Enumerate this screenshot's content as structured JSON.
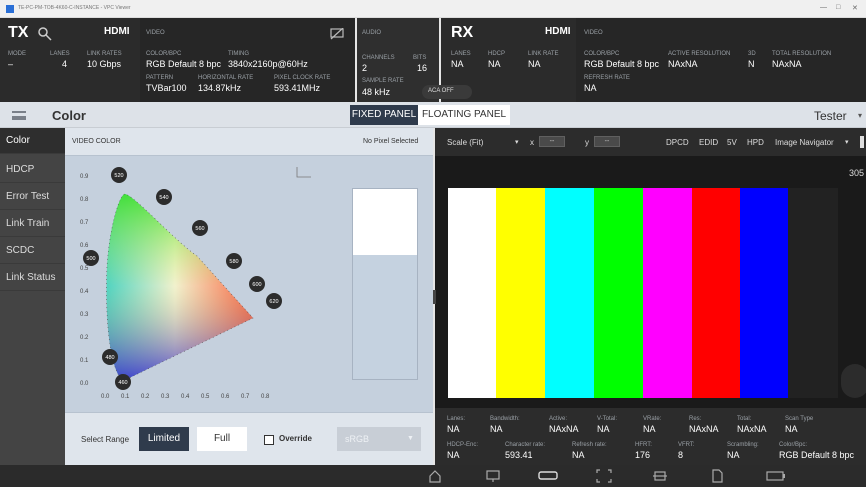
{
  "window": {
    "title": "TE-PC-PM-TOB-4K60-C-INSTANCE - VPC Viewer",
    "controls": [
      "—",
      "□",
      "✕"
    ]
  },
  "tx": {
    "label": "TX",
    "interface": "HDMI",
    "section": "VIDEO",
    "mode": {
      "label": "MODE",
      "value": "–"
    },
    "lanes": {
      "label": "LANES",
      "value": "4"
    },
    "link_rates": {
      "label": "LINK RATES",
      "value": "10 Gbps"
    },
    "color_bpc": {
      "label": "COLOR/BPC",
      "value": "RGB Default 8 bpc"
    },
    "timing": {
      "label": "TIMING",
      "value": "3840x2160p@60Hz"
    },
    "pattern": {
      "label": "PATTERN",
      "value": "TVBar100"
    },
    "horizontal_rate": {
      "label": "HORIZONTAL RATE",
      "value": "134.87kHz"
    },
    "pixel_clock_rate": {
      "label": "PIXEL CLOCK RATE",
      "value": "593.41MHz"
    }
  },
  "audio": {
    "section": "AUDIO",
    "channels": {
      "label": "CHANNELS",
      "value": "2"
    },
    "bits": {
      "label": "BITS",
      "value": "16"
    },
    "sample_rate": {
      "label": "SAMPLE RATE",
      "value": "48 kHz"
    },
    "aca": "ACA OFF"
  },
  "rx": {
    "label": "RX",
    "interface": "HDMI",
    "section": "VIDEO",
    "lanes": {
      "label": "LANES",
      "value": "NA"
    },
    "hdcp": {
      "label": "HDCP",
      "value": "NA"
    },
    "link_rate": {
      "label": "LINK RATE",
      "value": "NA"
    },
    "color_bpc": {
      "label": "COLOR/BPC",
      "value": "RGB Default 8 bpc"
    },
    "active_resolution": {
      "label": "ACTIVE RESOLUTION",
      "value": "NAxNA"
    },
    "three_d": {
      "label": "3D",
      "value": "N"
    },
    "total_resolution": {
      "label": "TOTAL RESOLUTION",
      "value": "NAxNA"
    },
    "refresh_rate": {
      "label": "REFRESH RATE",
      "value": "NA"
    }
  },
  "header": {
    "title": "Color",
    "fixed_panel": "FIXED PANEL",
    "floating_panel": "FLOATING PANEL",
    "user": "Tester"
  },
  "sidebar": {
    "items": [
      {
        "label": "Color"
      },
      {
        "label": "HDCP"
      },
      {
        "label": "Error Test"
      },
      {
        "label": "Link Train"
      },
      {
        "label": "SCDC"
      },
      {
        "label": "Link Status"
      }
    ]
  },
  "video_color": {
    "title": "VIDEO COLOR",
    "pixel_status": "No Pixel Selected",
    "axis_y": [
      "0.9",
      "0.8",
      "0.7",
      "0.6",
      "0.5",
      "0.4",
      "0.3",
      "0.2",
      "0.1",
      "0.0"
    ],
    "axis_x": [
      "0.0",
      "0.1",
      "0.2",
      "0.3",
      "0.4",
      "0.5",
      "0.6",
      "0.7",
      "0.8"
    ],
    "wavelengths": [
      "520",
      "540",
      "560",
      "580",
      "600",
      "620",
      "500",
      "480",
      "460"
    ],
    "select_range": "Select Range",
    "limited": "Limited",
    "full": "Full",
    "override": "Override",
    "colorspace": "sRGB"
  },
  "navigator": {
    "scale": "Scale (Fit)",
    "x_label": "x",
    "x_value": "--",
    "y_label": "y",
    "y_value": "--",
    "tabs": [
      "DPCD",
      "EDID",
      "5V",
      "HPD",
      "Image Navigator"
    ],
    "side_value": "305",
    "bars": [
      "#ffffff",
      "#ffff00",
      "#00ffff",
      "#00ff00",
      "#ff00ff",
      "#ff0000",
      "#0000ff",
      "#222222"
    ]
  },
  "rx_status": {
    "row1": [
      {
        "label": "Lanes:",
        "value": "NA"
      },
      {
        "label": "Bandwidth:",
        "value": "NA"
      },
      {
        "label": "Active:",
        "value": "NAxNA"
      },
      {
        "label": "V-Total:",
        "value": "NA"
      },
      {
        "label": "VRate:",
        "value": "NA"
      },
      {
        "label": "Res:",
        "value": "NAxNA"
      },
      {
        "label": "Total:",
        "value": "NAxNA"
      },
      {
        "label": "Scan Type",
        "value": "NA"
      }
    ],
    "row2": [
      {
        "label": "HDCP-Enc:",
        "value": "NA"
      },
      {
        "label": "Character rate:",
        "value": "593.41"
      },
      {
        "label": "Refresh rate:",
        "value": "NA"
      },
      {
        "label": "HFRT:",
        "value": "176"
      },
      {
        "label": "VFRT:",
        "value": "8"
      },
      {
        "label": "Scrambling:",
        "value": "NA"
      },
      {
        "label": "Color/Bpc:",
        "value": "RGB Default 8 bpc"
      }
    ]
  },
  "bottom_icons": [
    "home-icon",
    "monitor-icon",
    "hdmi-port-icon",
    "screen-capture-icon",
    "network-icon",
    "document-icon",
    "battery-icon"
  ]
}
